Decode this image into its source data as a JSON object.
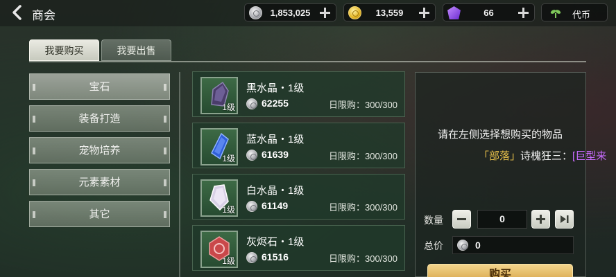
{
  "header": {
    "title": "商会",
    "currencies": [
      {
        "icon": "silver-coin-icon",
        "value": "1,853,025"
      },
      {
        "icon": "gold-coin-icon",
        "value": "13,559"
      },
      {
        "icon": "purple-gem-icon",
        "value": "66"
      }
    ],
    "token_label": "代币"
  },
  "tabs": [
    {
      "label": "我要购买",
      "active": true
    },
    {
      "label": "我要出售",
      "active": false
    }
  ],
  "categories": [
    {
      "label": "宝石",
      "selected": true
    },
    {
      "label": "装备打造",
      "selected": false
    },
    {
      "label": "宠物培养",
      "selected": false
    },
    {
      "label": "元素素材",
      "selected": false
    },
    {
      "label": "其它",
      "selected": false
    }
  ],
  "items": [
    {
      "name": "黑水晶・1级",
      "level": "1级",
      "price": "62255",
      "limit": "日限购：300/300",
      "icon": "black-crystal-icon"
    },
    {
      "name": "蓝水晶・1级",
      "level": "1级",
      "price": "61639",
      "limit": "日限购：300/300",
      "icon": "blue-crystal-icon"
    },
    {
      "name": "白水晶・1级",
      "level": "1级",
      "price": "61149",
      "limit": "日限购：300/300",
      "icon": "white-crystal-icon"
    },
    {
      "name": "灰烬石・1级",
      "level": "1级",
      "price": "61516",
      "limit": "日限购：300/300",
      "icon": "ash-stone-icon"
    }
  ],
  "panel": {
    "prompt": "请在左侧选择想购买的物品",
    "chat": {
      "tag": "「部落」",
      "speaker": "诗槐狂三：",
      "message": "[巨型来"
    },
    "quantity_label": "数量",
    "quantity_value": "0",
    "total_label": "总价",
    "total_value": "0",
    "buy_label": "购买"
  }
}
